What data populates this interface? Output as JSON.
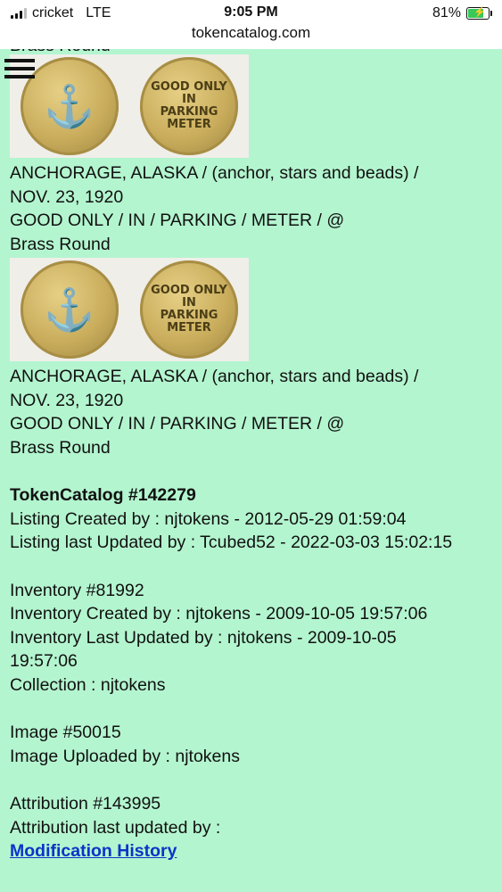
{
  "status_bar": {
    "carrier": "cricket",
    "network": "LTE",
    "time": "9:05 PM",
    "url": "tokencatalog.com",
    "battery": "81%",
    "battery_level": 0.81
  },
  "menu": {
    "icon": "hamburger-menu-icon"
  },
  "images": [
    {
      "type_label_cut": "Brass Round",
      "front_text": "ANCHORAGE, ALASKA / (anchor, stars and beads) /",
      "front_text_2": "NOV. 23, 1920",
      "back_text": "GOOD ONLY / IN / PARKING / METER / @",
      "material": "Brass Round"
    },
    {
      "front_text": "ANCHORAGE, ALASKA / (anchor, stars and beads) /",
      "front_text_2": "NOV. 23, 1920",
      "back_text": "GOOD ONLY / IN / PARKING / METER / @",
      "material": "Brass Round"
    }
  ],
  "coin_text": {
    "back_line1": "GOOD ONLY",
    "back_line2": "IN",
    "back_line3": "PARKING",
    "back_line4": "METER"
  },
  "listing": {
    "title": "TokenCatalog #142279",
    "created": "Listing Created by : njtokens - 2012-05-29 01:59:04",
    "updated": "Listing last Updated by : Tcubed52 - 2022-03-03 15:02:15"
  },
  "inventory": {
    "id": "Inventory #81992",
    "created": "Inventory Created by : njtokens - 2009-10-05 19:57:06",
    "updated": "Inventory Last Updated by : njtokens - 2009-10-05",
    "updated_time": "19:57:06",
    "collection": "Collection : njtokens"
  },
  "image_info": {
    "id": "Image #50015",
    "uploaded": "Image Uploaded by : njtokens"
  },
  "attribution": {
    "id": "Attribution #143995",
    "updated": "Attribution last updated by :",
    "link": "Modification History"
  }
}
